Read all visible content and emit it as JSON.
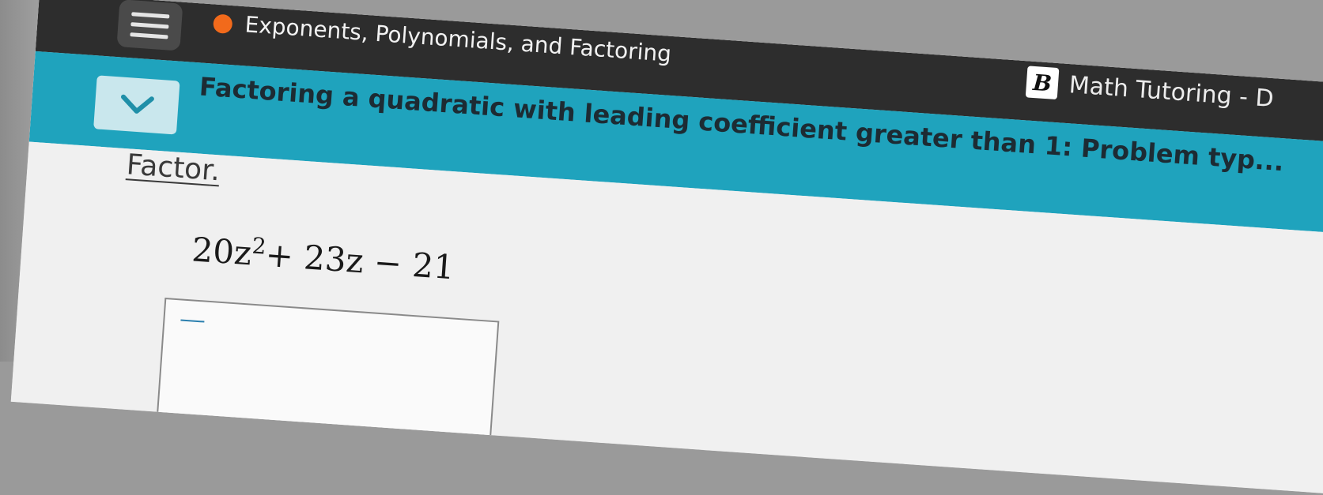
{
  "header": {
    "topic": "Exponents, Polynomials, and Factoring",
    "tutoring_tab": "Math Tutoring - D",
    "tutoring_logo_letter": "B",
    "topic_status_color": "#f26a1b"
  },
  "lesson": {
    "title": "Factoring a quadratic with leading coefficient greater than 1: Problem typ..."
  },
  "problem": {
    "instruction": "Factor",
    "instruction_end": ".",
    "expression": {
      "coefficient": "20z",
      "exponent": "2",
      "remainder": "+ 23z − 21"
    }
  },
  "icons": {
    "menu": "hamburger-menu-icon",
    "collapse": "chevron-down-icon"
  },
  "colors": {
    "accent": "#1fa3bd",
    "topbar": "#2d2d2d"
  }
}
